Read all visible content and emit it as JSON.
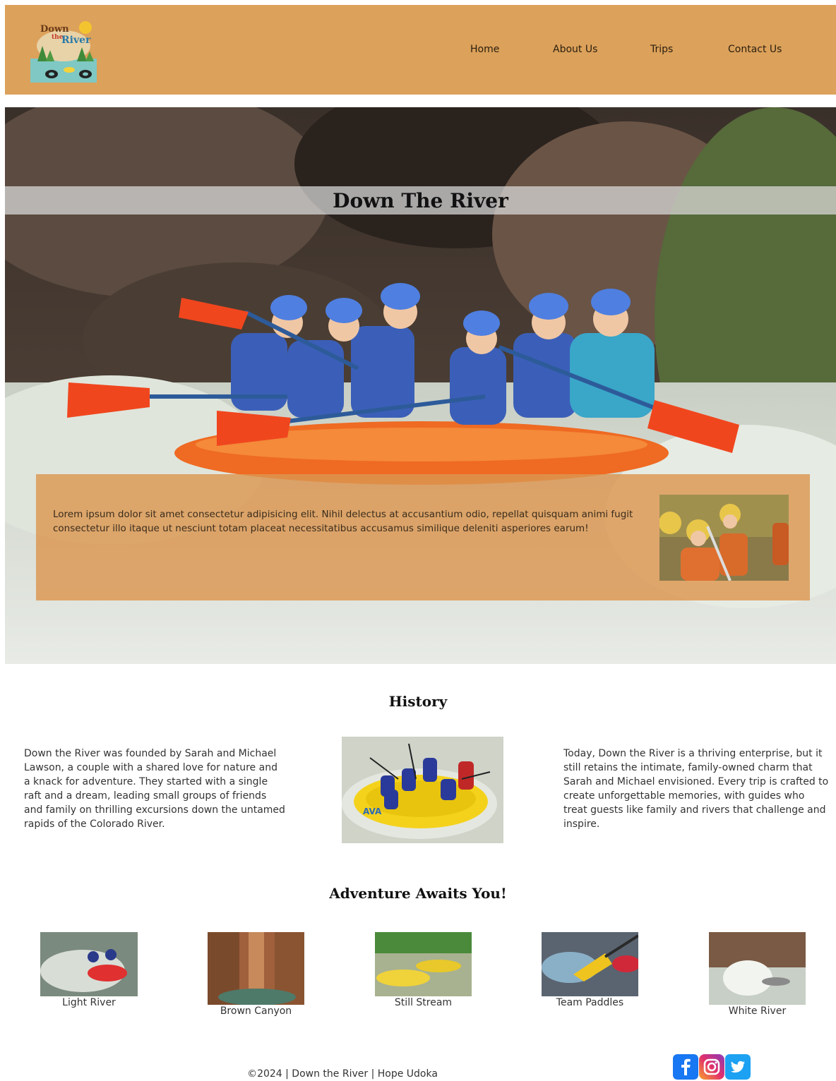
{
  "header": {
    "logo_text": [
      "Down",
      "the",
      "River"
    ],
    "nav": [
      {
        "label": "Home"
      },
      {
        "label": "About Us"
      },
      {
        "label": "Trips"
      },
      {
        "label": "Contact Us"
      }
    ],
    "background_color": "#dca15a"
  },
  "hero": {
    "title": "Down The River",
    "intro_text": "Lorem ipsum dolor sit amet consectetur adipisicing elit. Nihil delectus at accusantium odio, repellat quisquam animi fugit consectetur illo itaque ut nesciunt totam placeat necessitatibus accusamus similique deleniti asperiores earum!"
  },
  "history": {
    "title": "History",
    "left_text": "Down the River was founded by Sarah and Michael Lawson, a couple with a shared love for nature and a knack for adventure. They started with a single raft and a dream, leading small groups of friends and family on thrilling excursions down the untamed rapids of the Colorado River.",
    "right_text": "Today, Down the River is a thriving enterprise, but it still retains the intimate, family-owned charm that Sarah and Michael envisioned. Every trip is crafted to create unforgettable memories, with guides who treat guests like family and rivers that challenge and inspire."
  },
  "adventures": {
    "title": "Adventure Awaits You!",
    "items": [
      {
        "label": "Light River"
      },
      {
        "label": "Brown Canyon"
      },
      {
        "label": "Still Stream"
      },
      {
        "label": "Team Paddles"
      },
      {
        "label": "White River"
      }
    ]
  },
  "footer": {
    "copyright": "©2024 | Down the River | Hope Udoka",
    "social": [
      "facebook-icon",
      "instagram-icon",
      "twitter-icon"
    ]
  }
}
